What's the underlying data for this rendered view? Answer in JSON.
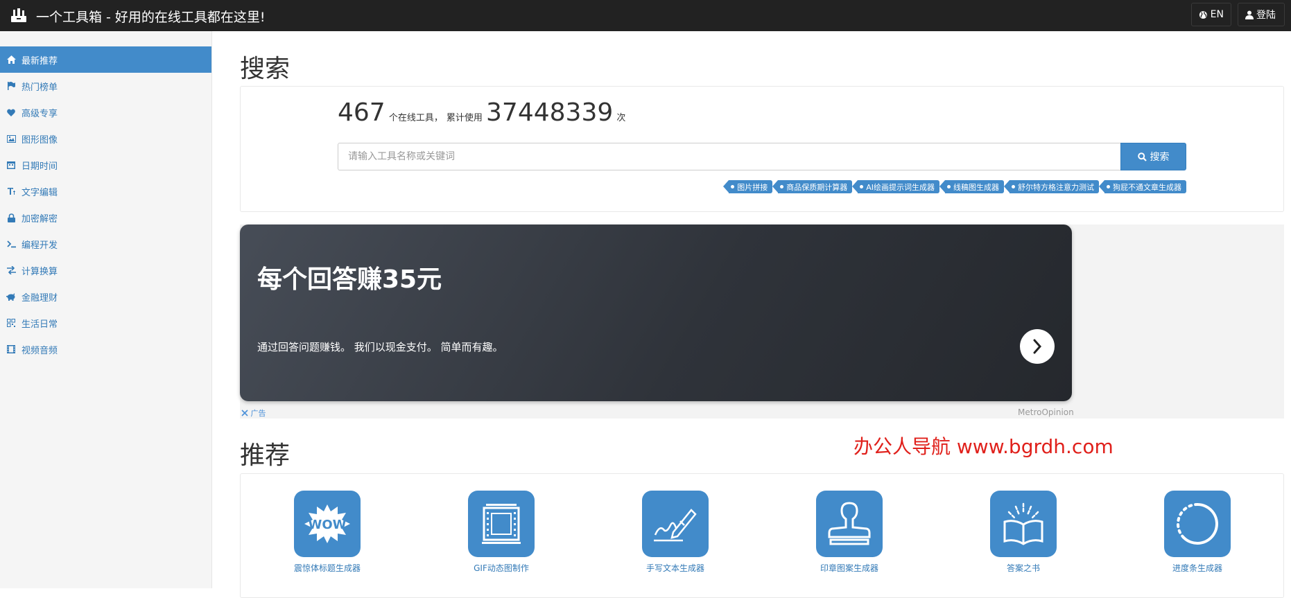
{
  "header": {
    "title": "一个工具箱 - 好用的在线工具都在这里!",
    "lang_label": "EN",
    "login_label": "登陆"
  },
  "sidebar": {
    "items": [
      {
        "label": "最新推荐",
        "icon": "home-icon",
        "active": true
      },
      {
        "label": "热门榜单",
        "icon": "flag-icon"
      },
      {
        "label": "高级专享",
        "icon": "heart-icon"
      },
      {
        "label": "图形图像",
        "icon": "picture-icon"
      },
      {
        "label": "日期时间",
        "icon": "calendar-icon"
      },
      {
        "label": "文字编辑",
        "icon": "text-icon"
      },
      {
        "label": "加密解密",
        "icon": "lock-icon"
      },
      {
        "label": "编程开发",
        "icon": "terminal-icon"
      },
      {
        "label": "计算换算",
        "icon": "transfer-icon"
      },
      {
        "label": "金融理财",
        "icon": "piggy-bank-icon"
      },
      {
        "label": "生活日常",
        "icon": "qrcode-icon"
      },
      {
        "label": "视频音频",
        "icon": "film-icon"
      }
    ]
  },
  "search": {
    "heading": "搜索",
    "tool_count": "467",
    "tool_count_suffix": "个在线工具，",
    "usage_prefix": "累计使用",
    "usage_count": "37448339",
    "usage_suffix": "次",
    "placeholder": "请输入工具名称或关键词",
    "button_label": "搜索",
    "tags": [
      "图片拼接",
      "商品保质期计算器",
      "AI绘画提示词生成器",
      "线稿图生成器",
      "舒尔特方格注意力测试",
      "狗屁不通文章生成器"
    ]
  },
  "ad": {
    "title": "每个回答赚35元",
    "description": "通过回答问题赚钱。 我们以现金支付。 简单而有趣。",
    "label": "广告",
    "brand": "MetroOpinion"
  },
  "watermark": "办公人导航 www.bgrdh.com",
  "recommend": {
    "heading": "推荐",
    "tools": [
      {
        "label": "震惊体标题生成器",
        "icon": "wow-icon"
      },
      {
        "label": "GIF动态图制作",
        "icon": "film-frame-icon"
      },
      {
        "label": "手写文本生成器",
        "icon": "handwriting-icon"
      },
      {
        "label": "印章图案生成器",
        "icon": "stamp-icon"
      },
      {
        "label": "答案之书",
        "icon": "book-icon"
      },
      {
        "label": "进度条生成器",
        "icon": "progress-circle-icon"
      }
    ]
  },
  "colors": {
    "topbar": "#222222",
    "accent": "#428bca",
    "link": "#337ab7",
    "watermark": "#e0201b"
  }
}
